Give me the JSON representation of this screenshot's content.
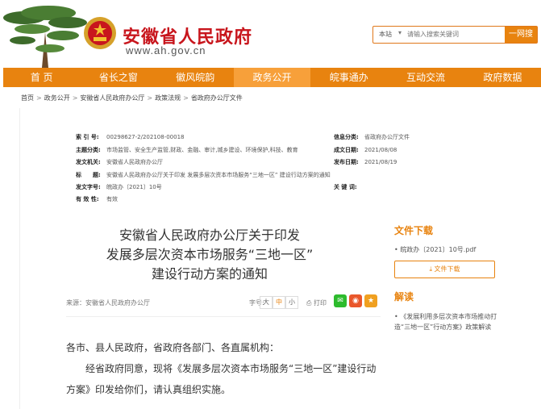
{
  "header": {
    "site_title": "安徽省人民政府",
    "site_url": "www.ah.gov.cn",
    "search": {
      "scope": "本站",
      "placeholder": "请输入搜索关键词",
      "button": "一网搜"
    }
  },
  "nav": {
    "items": [
      "首 页",
      "省长之窗",
      "徽风皖韵",
      "政务公开",
      "皖事通办",
      "互动交流",
      "政府数据"
    ],
    "active_index": 3
  },
  "breadcrumb": [
    "首页",
    "政务公开",
    "安徽省人民政府办公厅",
    "政策法规",
    "省政府办公厅文件"
  ],
  "meta": {
    "index_no": {
      "label": "索 引 号:",
      "value": "00298627-2/202108-00018"
    },
    "info_category": {
      "label": "信息分类:",
      "value": "省政府办公厅文件"
    },
    "topic": {
      "label": "主题分类:",
      "value": "市场监管、安全生产监管,财政、金融、审计,城乡建设、环境保护,科技、教育"
    },
    "issue_date": {
      "label": "成文日期:",
      "value": "2021/08/08"
    },
    "issuer": {
      "label": "发文机关:",
      "value": "安徽省人民政府办公厅"
    },
    "publish_date": {
      "label": "发布日期:",
      "value": "2021/08/19"
    },
    "title": {
      "label": "标　　题:",
      "value": "安徽省人民政府办公厅关于印发 发展多层次资本市场服务“三地一区” 建设行动方案的通知"
    },
    "doc_no": {
      "label": "发文字号:",
      "value": "皖政办〔2021〕10号"
    },
    "keywords": {
      "label": "关 键 词:",
      "value": ""
    },
    "validity": {
      "label": "有 效 性:",
      "value": "有效"
    }
  },
  "article": {
    "title_line1": "安徽省人民政府办公厅关于印发",
    "title_line2": "发展多层次资本市场服务“三地一区”",
    "title_line3": "建设行动方案的通知",
    "source": "来源：安徽省人民政府办公厅",
    "font_size_label": "字号:",
    "font_sizes": [
      "大",
      "中",
      "小"
    ],
    "active_font_size": 1,
    "print_label": "打印",
    "body_line1": "各市、县人民政府，省政府各部门、各直属机构：",
    "body_para2": "经省政府同意，现将《发展多层次资本市场服务“三地一区”建设行动方案》印发给你们，请认真组织实施。"
  },
  "aside": {
    "download_head": "文件下载",
    "file_name": "皖政办〔2021〕10号.pdf",
    "download_button": "文件下载",
    "interpret_head": "解读",
    "interpret_link": "《发展利用多层次资本市场推动打造“三地一区”行动方案》政策解读"
  },
  "colors": {
    "brand_red": "#c8161d",
    "accent_orange": "#e8830f",
    "nav_active": "#f7a03a",
    "wechat_green": "#2dbb2d",
    "weibo_orange": "#e9572b",
    "favorite_orange": "#f0a020"
  }
}
